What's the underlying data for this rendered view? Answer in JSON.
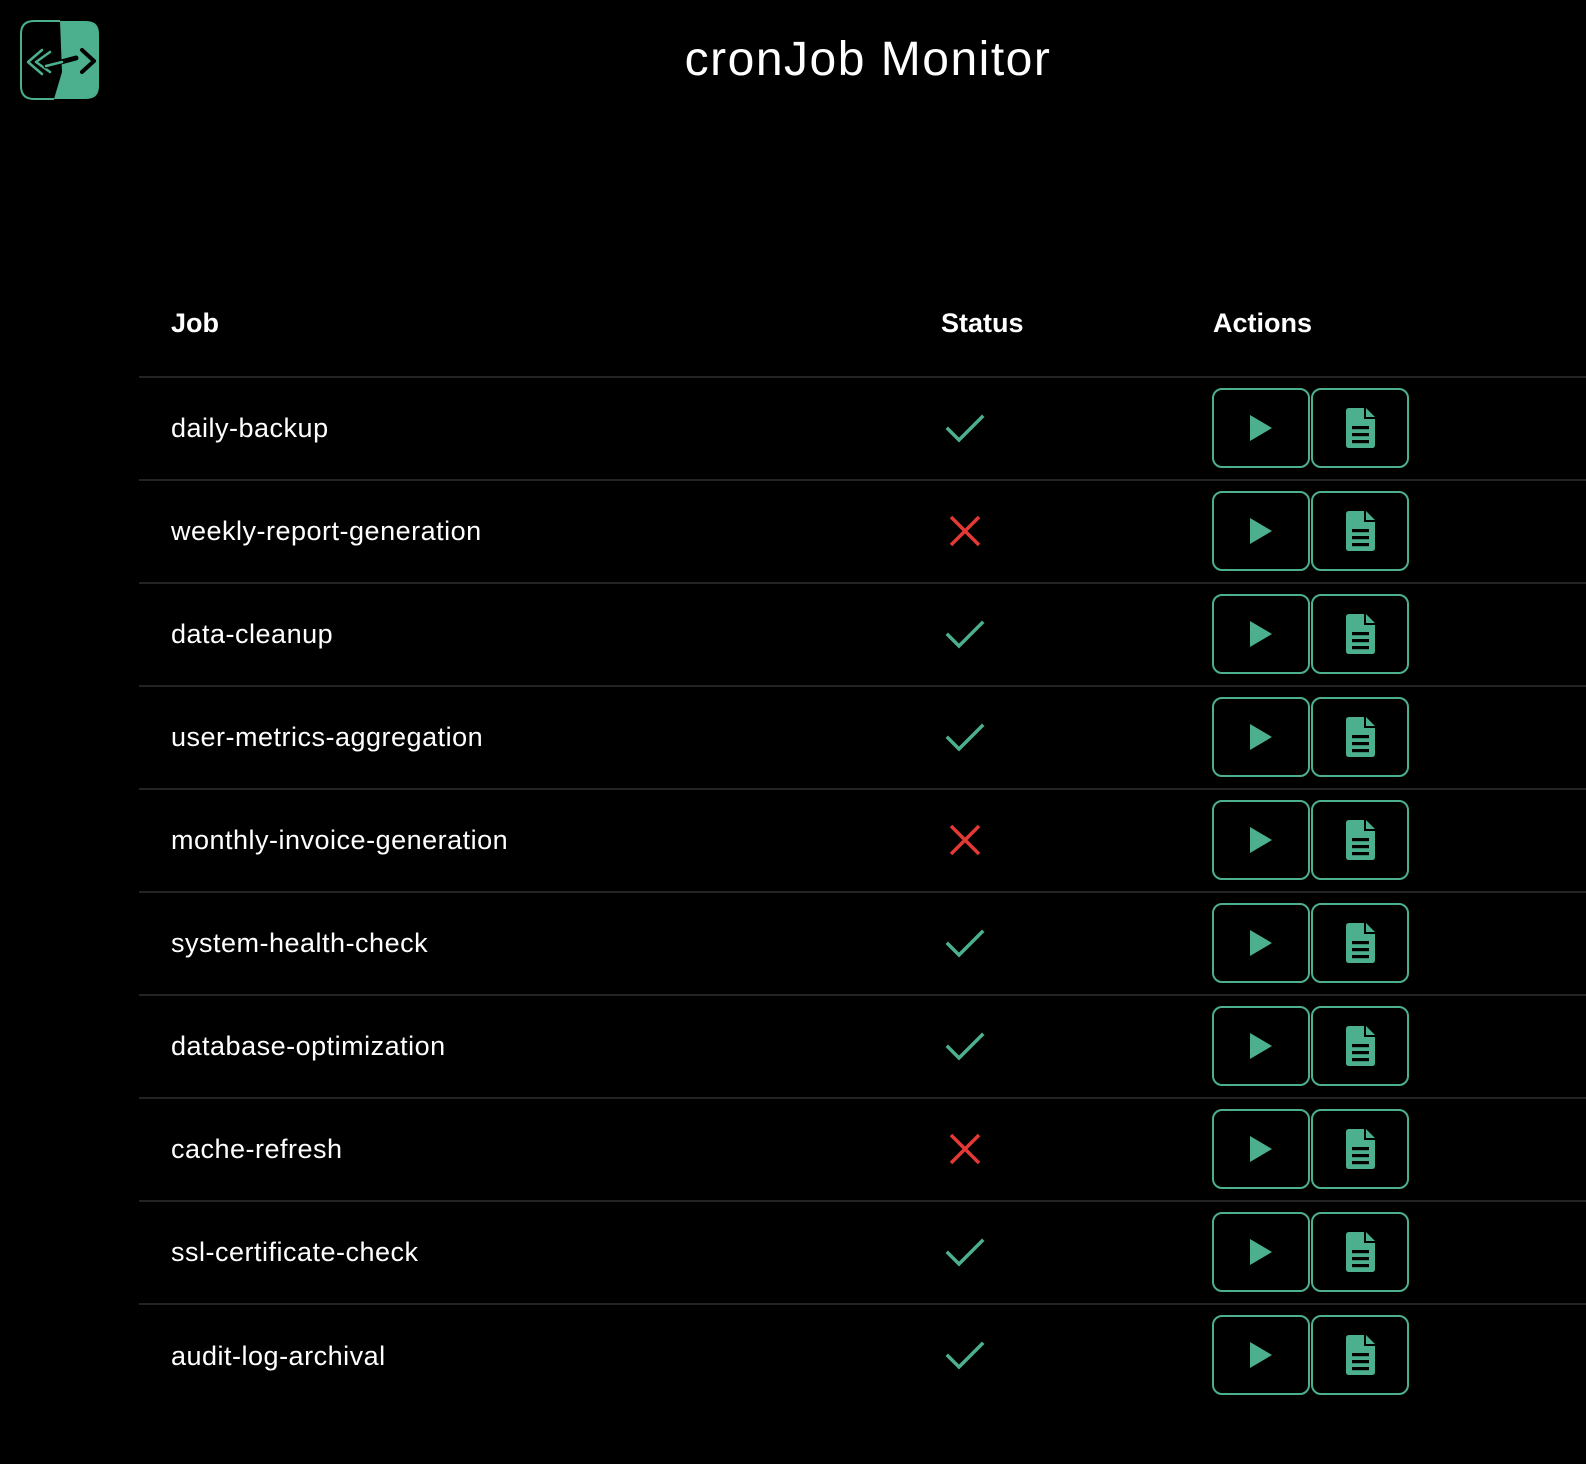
{
  "header": {
    "title": "cronJob Monitor",
    "logo_icon": "code-arrows-logo-icon"
  },
  "colors": {
    "background": "#000000",
    "accent": "#4caf8e",
    "success": "#4caf8e",
    "failure": "#e53935",
    "divider": "#232323"
  },
  "table": {
    "columns": [
      "Job",
      "Status",
      "Actions"
    ],
    "rows": [
      {
        "job": "daily-backup",
        "status": "success"
      },
      {
        "job": "weekly-report-generation",
        "status": "failure"
      },
      {
        "job": "data-cleanup",
        "status": "success"
      },
      {
        "job": "user-metrics-aggregation",
        "status": "success"
      },
      {
        "job": "monthly-invoice-generation",
        "status": "failure"
      },
      {
        "job": "system-health-check",
        "status": "success"
      },
      {
        "job": "database-optimization",
        "status": "success"
      },
      {
        "job": "cache-refresh",
        "status": "failure"
      },
      {
        "job": "ssl-certificate-check",
        "status": "success"
      },
      {
        "job": "audit-log-archival",
        "status": "success"
      }
    ],
    "action_icons": [
      "play-icon",
      "document-icon"
    ]
  }
}
